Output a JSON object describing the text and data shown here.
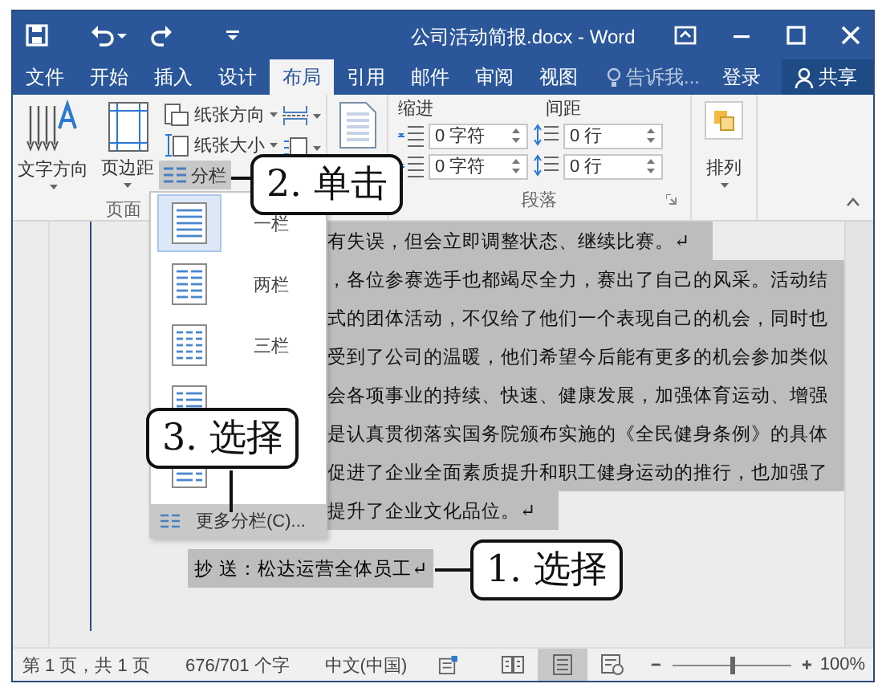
{
  "window": {
    "title": "公司活动简报.docx - Word"
  },
  "tabs": [
    {
      "label": "文件",
      "selected": false
    },
    {
      "label": "开始",
      "selected": false
    },
    {
      "label": "插入",
      "selected": false
    },
    {
      "label": "设计",
      "selected": false
    },
    {
      "label": "布局",
      "selected": true
    },
    {
      "label": "引用",
      "selected": false
    },
    {
      "label": "邮件",
      "selected": false
    },
    {
      "label": "审阅",
      "selected": false
    },
    {
      "label": "视图",
      "selected": false
    }
  ],
  "tell_me": {
    "placeholder": "告诉我..."
  },
  "account": {
    "sign_in": "登录",
    "share": "共享"
  },
  "ribbon": {
    "page_setup": {
      "text_direction": "文字方向",
      "margins": "页边距",
      "orientation": "纸张方向",
      "size": "纸张大小",
      "columns": "分栏",
      "group_label": "页面"
    },
    "paragraph": {
      "indent_label": "缩进",
      "spacing_label": "间距",
      "indent_left": "0 字符",
      "indent_right": "0 字符",
      "spacing_before": "0 行",
      "spacing_after": "0 行",
      "group_label": "段落"
    },
    "arrange": {
      "label": "排列"
    }
  },
  "columns_menu": {
    "items": [
      {
        "kind": "one",
        "label": "一栏",
        "selected": true
      },
      {
        "kind": "two",
        "label": "两栏",
        "selected": false
      },
      {
        "kind": "three",
        "label": "三栏",
        "selected": false
      },
      {
        "kind": "left",
        "selected": false
      },
      {
        "kind": "right",
        "selected": false
      }
    ],
    "more": "更多分栏(C)..."
  },
  "document": {
    "lines": [
      "有失误，但会立即调整状态、继续比赛。↵",
      "，各位参赛选手也都竭尽全力，赛出了自己的风采。活动结",
      "式的团体活动，不仅给了他们一个表现自己的机会，同时也",
      "受到了公司的温暖，他们希望今后能有更多的机会参加类似",
      "会各项事业的持续、快速、健康发展，加强体育运动、增强",
      "是认真贯彻落实国务院颁布实施的《全民健身条例》的具体",
      "促进了企业全面素质提升和职工健身运动的推行，也加强了",
      "提升了企业文化品位。↵"
    ],
    "cc": "抄 送：松达运营全体员工↵"
  },
  "callouts": [
    {
      "text": "2. 单击"
    },
    {
      "text": "3. 选择"
    },
    {
      "text": "1. 选择"
    }
  ],
  "status_bar": {
    "page": "第 1 页，共 1 页",
    "words": "676/701 个字",
    "language": "中文(中国)",
    "views": [
      {
        "kind": "read",
        "selected": false
      },
      {
        "kind": "print",
        "selected": true
      },
      {
        "kind": "web",
        "selected": false
      }
    ],
    "zoom": {
      "level": 0.5,
      "reading": "100%"
    }
  }
}
